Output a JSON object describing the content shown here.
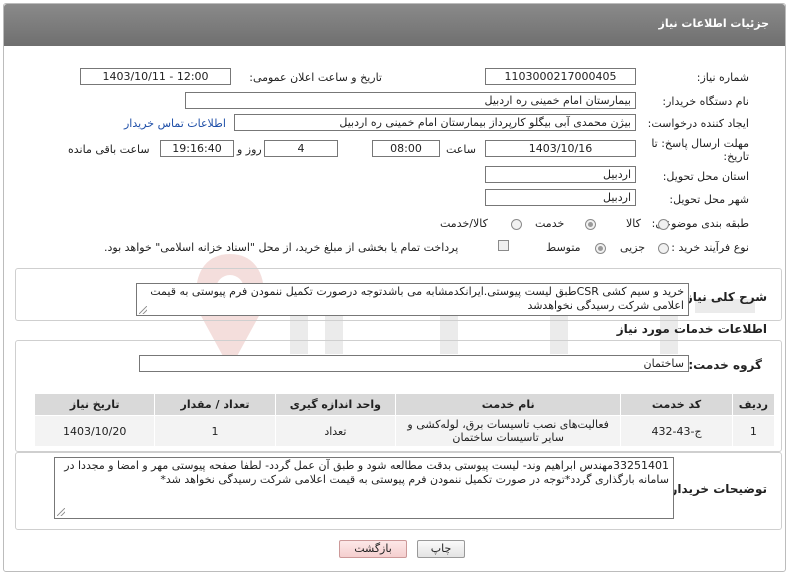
{
  "header": {
    "title": "جزئیات اطلاعات نیاز"
  },
  "fields": {
    "need_number_label": "شماره نیاز:",
    "need_number": "1103000217000405",
    "announce_label": "تاریخ و ساعت اعلان عمومی:",
    "announce_value": "1403/10/11 - 12:00",
    "buyer_org_label": "نام دستگاه خریدار:",
    "buyer_org": "بیمارستان امام خمینی  ره  اردبیل",
    "creator_label": "ایجاد کننده درخواست:",
    "creator": "بیژن محمدی آبی بیگلو کارپرداز بیمارستان امام خمینی  ره  اردبیل",
    "contact_link": "اطلاعات تماس خریدار",
    "deadline_label_1": "مهلت ارسال پاسخ: تا",
    "deadline_label_2": "تاریخ:",
    "deadline_date": "1403/10/16",
    "time_label": "ساعت",
    "deadline_time": "08:00",
    "days_value": "4",
    "days_label": "روز و",
    "remaining_time": "19:16:40",
    "remaining_label": "ساعت باقی مانده",
    "province_label": "استان محل تحویل:",
    "province": "اردبیل",
    "city_label": "شهر محل تحویل:",
    "city": "اردبیل",
    "category_label": "طبقه بندی موضوعی:",
    "category_options": [
      "کالا",
      "خدمت",
      "کالا/خدمت"
    ],
    "category_selected": "خدمت",
    "process_label": "نوع فرآیند خرید :",
    "process_options": [
      "جزیی",
      "متوسط"
    ],
    "process_selected": "متوسط",
    "treasury_text": "پرداخت تمام یا بخشی از مبلغ خرید، از محل \"اسناد خزانه اسلامی\" خواهد بود."
  },
  "summary": {
    "label": "شرح کلی نیاز:",
    "text": "خرید و سیم کشی CSRطبق لیست پیوستی.ایرانکدمشابه می باشدتوجه درصورت تکمیل ننمودن فرم پیوستی به قیمت اعلامی شرکت رسیدگی نخواهدشد"
  },
  "services": {
    "section_title": "اطلاعات خدمات مورد نیاز",
    "group_label": "گروه خدمت:",
    "group_value": "ساختمان",
    "columns": [
      "ردیف",
      "کد خدمت",
      "نام خدمت",
      "واحد اندازه گیری",
      "تعداد / مقدار",
      "تاریخ نیاز"
    ],
    "rows": [
      {
        "row": "1",
        "code": "ج-43-432",
        "name": "فعالیت‌های نصب تاسیسات برق، لوله‌کشی و سایر تاسیسات ساختمان",
        "unit": "تعداد",
        "qty": "1",
        "date": "1403/10/20"
      }
    ]
  },
  "buyer_notes": {
    "label": "توضیحات خریدار:",
    "text": "33251401مهندس ابراهیم وند- لیست پیوستی بدقت مطالعه شود و طبق آن عمل گردد- لطفا صفحه پیوستی مهر و امضا و مجددا در سامانه بارگذاری گردد*توجه در صورت تکمیل ننمودن فرم پیوستی به قیمت اعلامی شرکت رسیدگی نخواهد شد*"
  },
  "buttons": {
    "print": "چاپ",
    "back": "بازگشت"
  },
  "colors": {
    "header_bg": "#7d7d7d",
    "link": "#1f4fa8",
    "table_head": "#d9d9d9",
    "back_button": "#f5cfcf"
  },
  "icons": {
    "watermark": "aria-tender-watermark-icon"
  }
}
